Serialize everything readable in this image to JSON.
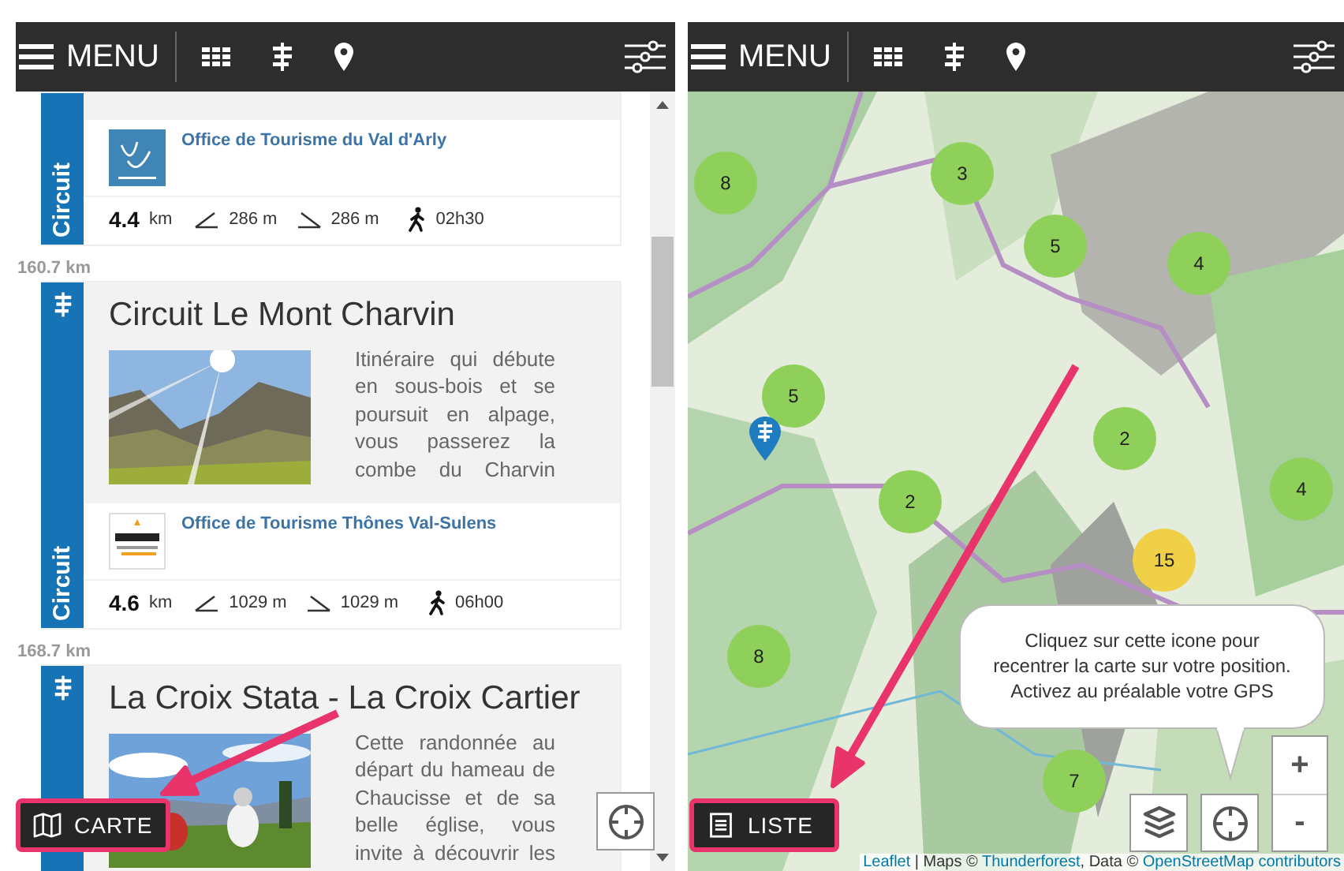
{
  "list_view": {
    "header": {
      "menu_label": "MENU"
    },
    "cards": [
      {
        "type_label": "Circuit",
        "organisation": "Office de Tourisme du Val d'Arly",
        "length": "4.4",
        "length_unit": "km",
        "ascent": "286 m",
        "descent": "286 m",
        "duration": "02h30"
      },
      {
        "distance_before": "160.7 km",
        "type_label": "Circuit",
        "title": "Circuit Le Mont Charvin",
        "description": "Itinéraire qui débute en sous-bois et se poursuit en alpage, vous passerez la combe du Charvin",
        "organisation": "Office de Tourisme Thônes Val-Sulens",
        "length": "4.6",
        "length_unit": "km",
        "ascent": "1029 m",
        "descent": "1029 m",
        "duration": "06h00"
      },
      {
        "distance_before": "168.7 km",
        "title": "La Croix Stata - La Croix Cartier",
        "description": "Cette randonnée au départ du hameau de Chaucisse et de sa belle église, vous invite à découvrir les"
      }
    ],
    "map_button": {
      "label": "CARTE"
    }
  },
  "map_view": {
    "header": {
      "menu_label": "MENU"
    },
    "clusters": [
      {
        "count": "8",
        "color": "#8fd05b"
      },
      {
        "count": "3",
        "color": "#8fd05b"
      },
      {
        "count": "5",
        "color": "#8fd05b"
      },
      {
        "count": "4",
        "color": "#8fd05b"
      },
      {
        "count": "5",
        "color": "#8fd05b"
      },
      {
        "count": "2",
        "color": "#8fd05b"
      },
      {
        "count": "4",
        "color": "#8fd05b"
      },
      {
        "count": "2",
        "color": "#8fd05b"
      },
      {
        "count": "15",
        "color": "#f0d046"
      },
      {
        "count": "8",
        "color": "#8fd05b"
      },
      {
        "count": "7",
        "color": "#8fd05b"
      }
    ],
    "tooltip": "Cliquez sur cette icone pour\nrecentrer la carte sur votre position.\nActivez au préalable votre GPS",
    "zoom_in": "+",
    "zoom_out": "-",
    "list_button": {
      "label": "LISTE"
    },
    "attribution": [
      {
        "text": "Leaflet",
        "link": true
      },
      {
        "text": " | Maps © ",
        "link": false
      },
      {
        "text": "Thunderforest",
        "link": true
      },
      {
        "text": ", Data © ",
        "link": false
      },
      {
        "text": "OpenStreetMap contributors",
        "link": true
      }
    ]
  }
}
